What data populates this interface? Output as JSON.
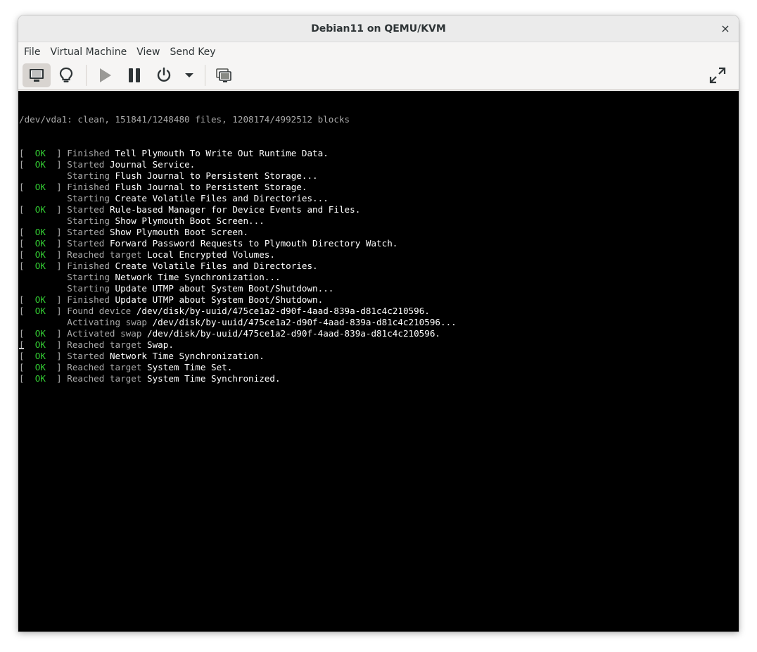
{
  "window": {
    "title": "Debian11 on QEMU/KVM",
    "close_label": "×"
  },
  "menu": [
    "File",
    "Virtual Machine",
    "View",
    "Send Key"
  ],
  "toolbar": {
    "icons": [
      "console-icon",
      "details-bulb-icon",
      "run-icon",
      "pause-icon",
      "power-icon",
      "power-menu-chevron-icon",
      "snapshots-icon",
      "fullscreen-icon"
    ]
  },
  "console": {
    "header": "/dev/vda1: clean, 151841/1248480 files, 1208174/4992512 blocks",
    "ok_label": "  OK  ",
    "lines": [
      {
        "type": "ok",
        "verb": "Finished",
        "rest": "Tell Plymouth To Write Out Runtime Data."
      },
      {
        "type": "ok",
        "verb": "Started",
        "rest": "Journal Service."
      },
      {
        "type": "start",
        "verb": "Starting",
        "rest": "Flush Journal to Persistent Storage..."
      },
      {
        "type": "ok",
        "verb": "Finished",
        "rest": "Flush Journal to Persistent Storage."
      },
      {
        "type": "start",
        "verb": "Starting",
        "rest": "Create Volatile Files and Directories..."
      },
      {
        "type": "ok",
        "verb": "Started",
        "rest": "Rule-based Manager for Device Events and Files."
      },
      {
        "type": "start",
        "verb": "Starting",
        "rest": "Show Plymouth Boot Screen..."
      },
      {
        "type": "ok",
        "verb": "Started",
        "rest": "Show Plymouth Boot Screen."
      },
      {
        "type": "ok",
        "verb": "Started",
        "rest": "Forward Password Requests to Plymouth Directory Watch."
      },
      {
        "type": "ok",
        "verb": "Reached target",
        "rest": "Local Encrypted Volumes."
      },
      {
        "type": "ok",
        "verb": "Finished",
        "rest": "Create Volatile Files and Directories."
      },
      {
        "type": "start",
        "verb": "Starting",
        "rest": "Network Time Synchronization..."
      },
      {
        "type": "start",
        "verb": "Starting",
        "rest": "Update UTMP about System Boot/Shutdown..."
      },
      {
        "type": "ok",
        "verb": "Finished",
        "rest": "Update UTMP about System Boot/Shutdown."
      },
      {
        "type": "ok",
        "verb": "Found device",
        "rest": "/dev/disk/by-uuid/475ce1a2-d90f-4aad-839a-d81c4c210596."
      },
      {
        "type": "start",
        "verb": "Activating swap",
        "rest": "/dev/disk/by-uuid/475ce1a2-d90f-4aad-839a-d81c4c210596..."
      },
      {
        "type": "ok",
        "verb": "Activated swap",
        "rest": "/dev/disk/by-uuid/475ce1a2-d90f-4aad-839a-d81c4c210596."
      },
      {
        "type": "ok",
        "verb": "Reached target",
        "rest": "Swap."
      },
      {
        "type": "ok",
        "verb": "Started",
        "rest": "Network Time Synchronization."
      },
      {
        "type": "ok",
        "verb": "Reached target",
        "rest": "System Time Set."
      },
      {
        "type": "ok",
        "verb": "Reached target",
        "rest": "System Time Synchronized."
      }
    ]
  }
}
